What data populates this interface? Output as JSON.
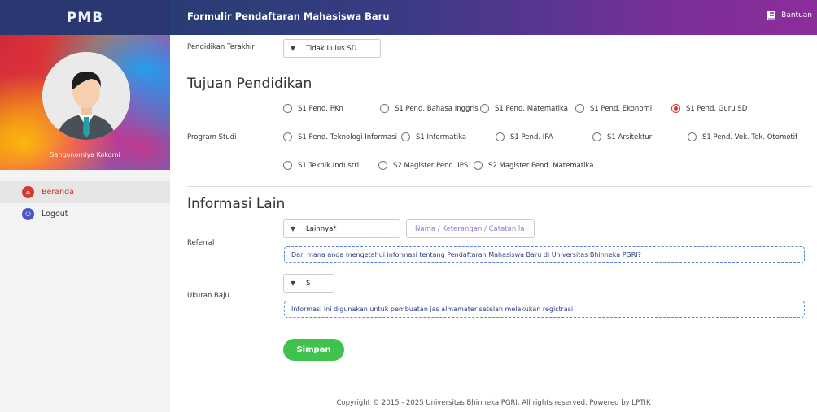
{
  "header": {
    "brand": "PMB",
    "title": "Formulir Pendaftaran Mahasiswa Baru",
    "help_label": "Bantuan"
  },
  "sidebar": {
    "username": "Sangonomiya Kokomi",
    "items": [
      {
        "label": "Beranda",
        "icon": "home-icon",
        "active": true
      },
      {
        "label": "Logout",
        "icon": "power-icon",
        "active": false
      }
    ]
  },
  "form": {
    "pendidikan": {
      "label": "Pendidikan Terakhir",
      "value": "Tidak Lulus SD"
    },
    "tujuan": {
      "heading": "Tujuan Pendidikan",
      "program_label": "Program Studi",
      "options": [
        "S1 Pend. PKn",
        "S1 Pend. Bahasa Inggris",
        "S1 Pend. Matematika",
        "S1 Pend. Ekonomi",
        "S1 Pend. Guru SD",
        "S1 Pend. Teknologi Informasi",
        "S1 Informatika",
        "S1 Pend. IPA",
        "S1 Arsitektur",
        "S1 Pend. Vok. Tek. Otomotif",
        "S1 Teknik Industri",
        "S2 Magister Pend. IPS",
        "S2 Magister Pend. Matematika"
      ],
      "selected": "S1 Pend. Guru SD"
    },
    "lain": {
      "heading": "Informasi Lain",
      "referral_label": "Referral",
      "referral_value": "Lainnya*",
      "referral_note_placeholder": "Nama / Keterangan / Catatan la",
      "referral_help": "Dari mana anda mengetahui informasi tentang Pendaftaran Mahasiswa Baru di Universitas Bhinneka PGRI?",
      "ukuran_label": "Ukuran Baju",
      "ukuran_value": "S",
      "ukuran_help": "Informasi ini digunakan untuk pembuatan jas almamater setelah melakukan registrasi"
    },
    "submit_label": "Simpan"
  },
  "footer": {
    "text": "Copyright © 2015 - 2025 Universitas Bhinneka PGRI. All rights reserved. Powered by LPTIK"
  },
  "colors": {
    "accent_green": "#3fc34e",
    "accent_red": "#e4342b",
    "header_dark": "#2a3770",
    "note_border": "#5a83d6"
  }
}
